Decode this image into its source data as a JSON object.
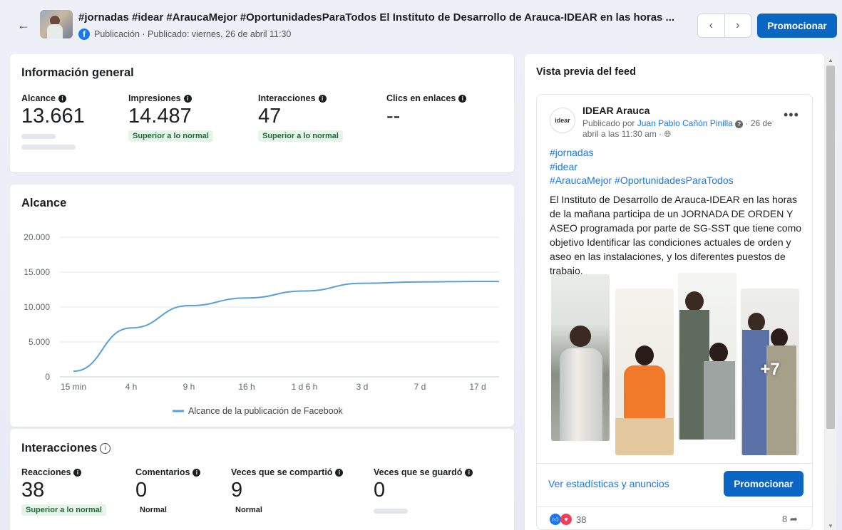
{
  "header": {
    "title": "#jornadas #idear #AraucaMejor #OportunidadesParaTodos El Instituto de Desarrollo de Arauca-IDEAR en las horas ...",
    "subtitle": "Publicación · Publicado: viernes, 26 de abril 11:30",
    "promote_label": "Promocionar"
  },
  "general": {
    "title": "Información general",
    "metrics": [
      {
        "label": "Alcance",
        "value": "13.661",
        "badge": ""
      },
      {
        "label": "Impresiones",
        "value": "14.487",
        "badge": "Superior a lo normal"
      },
      {
        "label": "Interacciones",
        "value": "47",
        "badge": "Superior a lo normal"
      },
      {
        "label": "Clics en enlaces",
        "value": "--",
        "badge": ""
      }
    ]
  },
  "reach_chart": {
    "title": "Alcance",
    "legend": "Alcance de la publicación de Facebook"
  },
  "chart_data": {
    "type": "line",
    "title": "Alcance",
    "x": [
      "15 min",
      "4 h",
      "9 h",
      "16 h",
      "1 d 6 h",
      "3 d",
      "7 d",
      "17 d"
    ],
    "series": [
      {
        "name": "Alcance de la publicación de Facebook",
        "values": [
          800,
          7000,
          10200,
          11300,
          12300,
          13400,
          13600,
          13661
        ]
      }
    ],
    "yticks": [
      "0",
      "5.000",
      "10.000",
      "15.000",
      "20.000"
    ],
    "ylim": [
      0,
      20000
    ],
    "grid": true,
    "legend_position": "bottom",
    "color": "#5aa0d8"
  },
  "interactions": {
    "title": "Interacciones",
    "metrics": [
      {
        "label": "Reacciones",
        "value": "38",
        "badge": "Superior a lo normal"
      },
      {
        "label": "Comentarios",
        "value": "0",
        "badge": "Normal"
      },
      {
        "label": "Veces que se compartió",
        "value": "9",
        "badge": "Normal"
      },
      {
        "label": "Veces que se guardó",
        "value": "0",
        "badge": ""
      }
    ]
  },
  "feed": {
    "title": "Vista previa del feed",
    "avatar_text": "idear",
    "page_name": "IDEAR Arauca",
    "published_by_prefix": "Publicado por ",
    "author": "Juan Pablo Cañón Pinilla",
    "date_text": " · 26 de abril a las 11:30 am · ",
    "tags": [
      "#jornadas",
      "#idear",
      "#AraucaMejor #OportunidadesParaTodos"
    ],
    "body": "El Instituto de Desarrollo de Arauca-IDEAR en las horas de la mañana participa de un JORNADA DE ORDEN Y ASEO programada por parte de SG-SST que tiene como objetivo Identificar las condiciones actuales de orden y aseo en las instalaciones, y los diferentes puestos de trabajo.",
    "more_photos": "+7",
    "stats_link": "Ver estadísticas y anuncios",
    "promote_label": "Promocionar",
    "reactions_count": "38",
    "shares_count": "8"
  }
}
